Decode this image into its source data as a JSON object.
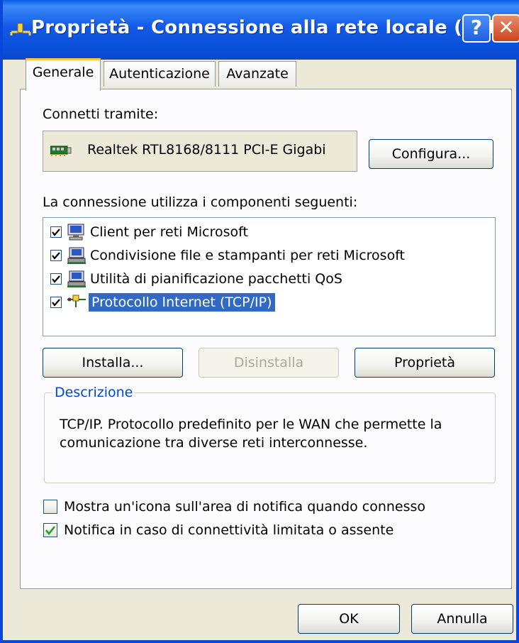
{
  "window": {
    "title": "Proprietà - Connessione alla rete locale (LAN...",
    "help_glyph": "?",
    "close_glyph": "✕"
  },
  "tabs": [
    {
      "label": "Generale",
      "active": true
    },
    {
      "label": "Autenticazione",
      "active": false
    },
    {
      "label": "Avanzate",
      "active": false
    }
  ],
  "general": {
    "connect_using_label": "Connetti tramite:",
    "adapter_name": "Realtek RTL8168/8111 PCI-E Gigabi",
    "configure_button": "Configura...",
    "components_label": "La connessione utilizza i componenti seguenti:",
    "components": [
      {
        "label": "Client per reti Microsoft",
        "checked": true,
        "icon": "network-client-icon",
        "selected": false
      },
      {
        "label": "Condivisione file e stampanti per reti Microsoft",
        "checked": true,
        "icon": "network-service-icon",
        "selected": false
      },
      {
        "label": "Utilità di pianificazione pacchetti QoS",
        "checked": true,
        "icon": "network-service-icon",
        "selected": false
      },
      {
        "label": "Protocollo Internet (TCP/IP)",
        "checked": true,
        "icon": "protocol-icon",
        "selected": true
      }
    ],
    "install_button": "Installa...",
    "uninstall_button": "Disinstalla",
    "properties_button": "Proprietà",
    "description_legend": "Descrizione",
    "description_text": "TCP/IP. Protocollo predefinito per le WAN che permette la comunicazione tra diverse reti interconnesse.",
    "show_icon_option": {
      "label": "Mostra un'icona sull'area di notifica quando connesso",
      "checked": false
    },
    "notify_option": {
      "label": "Notifica in caso di connettività limitata o assente",
      "checked": true
    }
  },
  "footer": {
    "ok_button": "OK",
    "cancel_button": "Annulla"
  },
  "colors": {
    "titlebar": "#0a4ed8",
    "selection": "#316ac5",
    "group_legend": "#0046d5",
    "tab_highlight": "#ffc83c"
  }
}
